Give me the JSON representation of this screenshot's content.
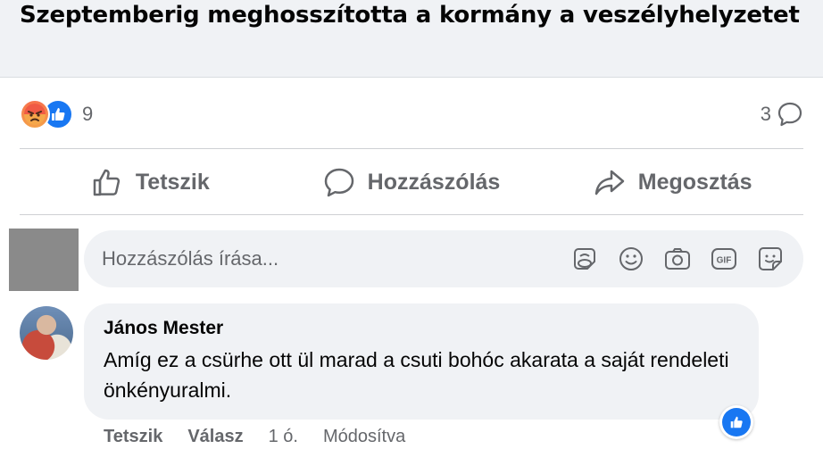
{
  "post": {
    "title": "Szeptemberig meghosszította a kormány a veszélyhelyzetet"
  },
  "stats": {
    "reaction_icons": [
      "angry-icon",
      "like-icon"
    ],
    "reaction_count": "9",
    "comment_count": "3"
  },
  "actions": {
    "like": "Tetszik",
    "comment": "Hozzászólás",
    "share": "Megosztás"
  },
  "composer": {
    "placeholder": "Hozzászólás írása...",
    "icons": [
      "avatar-sticker-icon",
      "emoji-icon",
      "camera-icon",
      "gif-icon",
      "sticker-icon"
    ]
  },
  "comment": {
    "author": "János Mester",
    "text": "Amíg ez a csürhe ott ül marad a csuti bohóc akarata a saját rendeleti önkényuralmi.",
    "like_label": "Tetszik",
    "reply_label": "Válasz",
    "time": "1 ó.",
    "edited": "Módosítva"
  },
  "colors": {
    "accent": "#1877f2",
    "muted_text": "#65676b",
    "bubble_bg": "#f0f2f5"
  }
}
